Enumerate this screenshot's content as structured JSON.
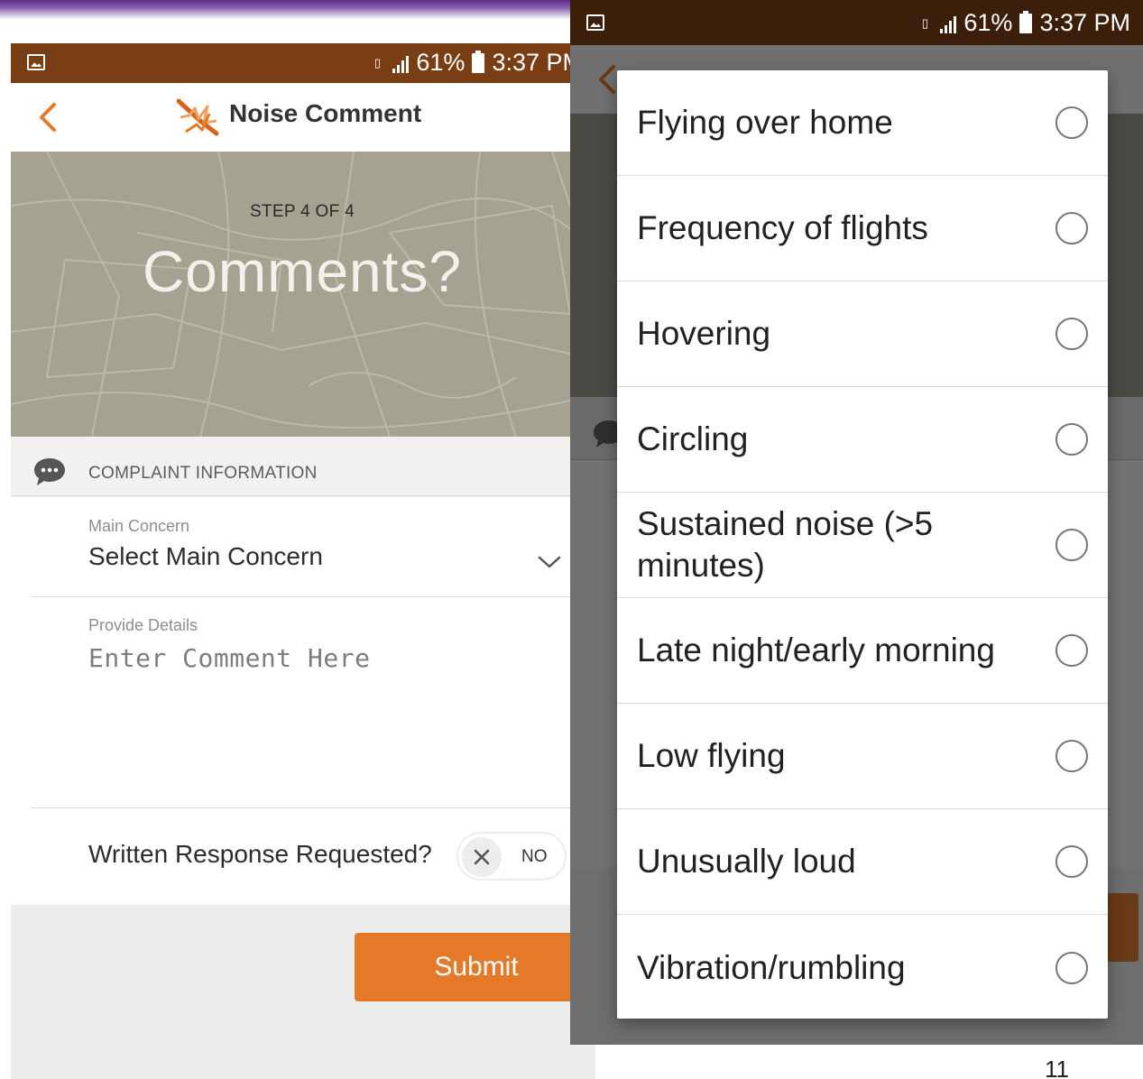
{
  "status_bar": {
    "battery": "61%",
    "time": "3:37 PM"
  },
  "app_bar": {
    "title": "Noise Comment"
  },
  "hero": {
    "step_label": "STEP 4 OF 4",
    "title": "Comments?"
  },
  "section": {
    "title": "COMPLAINT INFORMATION"
  },
  "form": {
    "main_concern_label": "Main Concern",
    "main_concern_value": "Select Main Concern",
    "details_label": "Provide Details",
    "details_placeholder": "Enter Comment Here",
    "written_response_label": "Written Response Requested?",
    "written_response_value": "NO",
    "submit_label": "Submit"
  },
  "dialog": {
    "options": [
      "Flying over home",
      "Frequency of flights",
      "Hovering",
      "Circling",
      "Sustained noise (>5 minutes)",
      "Late night/early morning",
      "Low flying",
      "Unusually loud",
      "Vibration/rumbling"
    ]
  },
  "slide": {
    "page_number": "11"
  },
  "colors": {
    "brand_orange": "#e47a28",
    "status_brown": "#7a3e14",
    "hero_bg": "#a6a291"
  }
}
